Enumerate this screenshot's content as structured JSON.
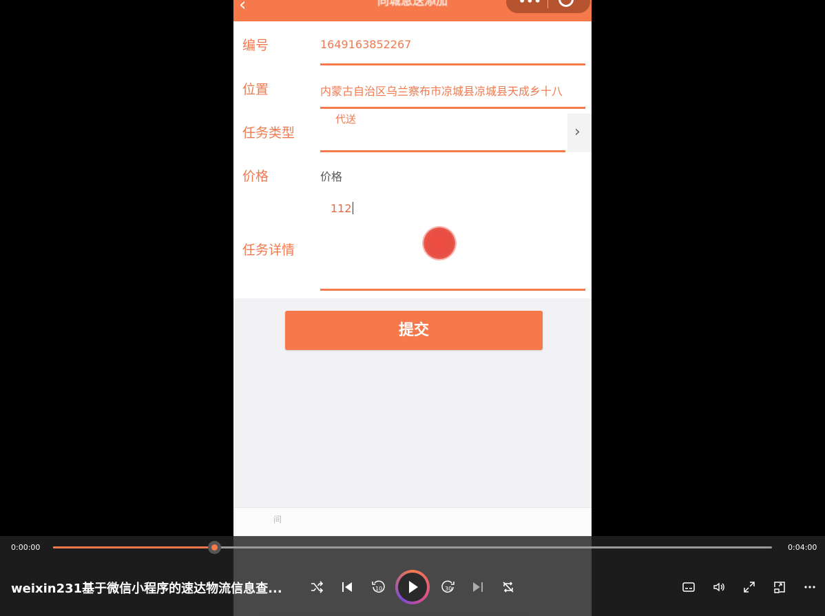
{
  "mini_program": {
    "title": "同城急送添加",
    "capsule_dots": "•••",
    "fields": {
      "number": {
        "label": "编号",
        "value": "1649163852267"
      },
      "location": {
        "label": "位置",
        "value": "内蒙古自治区乌兰察布市凉城县凉城县天成乡十八"
      },
      "task_type": {
        "label": "任务类型",
        "value": "代送"
      },
      "price": {
        "label": "价格",
        "placeholder": "价格"
      },
      "task_detail": {
        "label": "任务详情",
        "value": "112"
      }
    },
    "submit_label": "提交",
    "bottom_ghost_text": "间"
  },
  "player": {
    "current_time": "0:00:00",
    "total_time": "0:04:00",
    "progress": 0.225,
    "title": "weixin231基于微信小程序的速达物流信息查...",
    "accent_color": "#f5794a"
  },
  "icons": {
    "back": "chevron-left-icon",
    "shuffle": "shuffle-icon",
    "previous": "skip-previous-icon",
    "rewind": "rewind-10-icon",
    "play": "play-icon",
    "forward": "forward-30-icon",
    "next": "skip-next-icon",
    "repeat": "repeat-off-icon",
    "subtitles": "subtitles-icon",
    "volume": "volume-icon",
    "fullscreen": "fullscreen-icon",
    "miniplayer": "mini-player-icon",
    "more": "more-icon"
  }
}
